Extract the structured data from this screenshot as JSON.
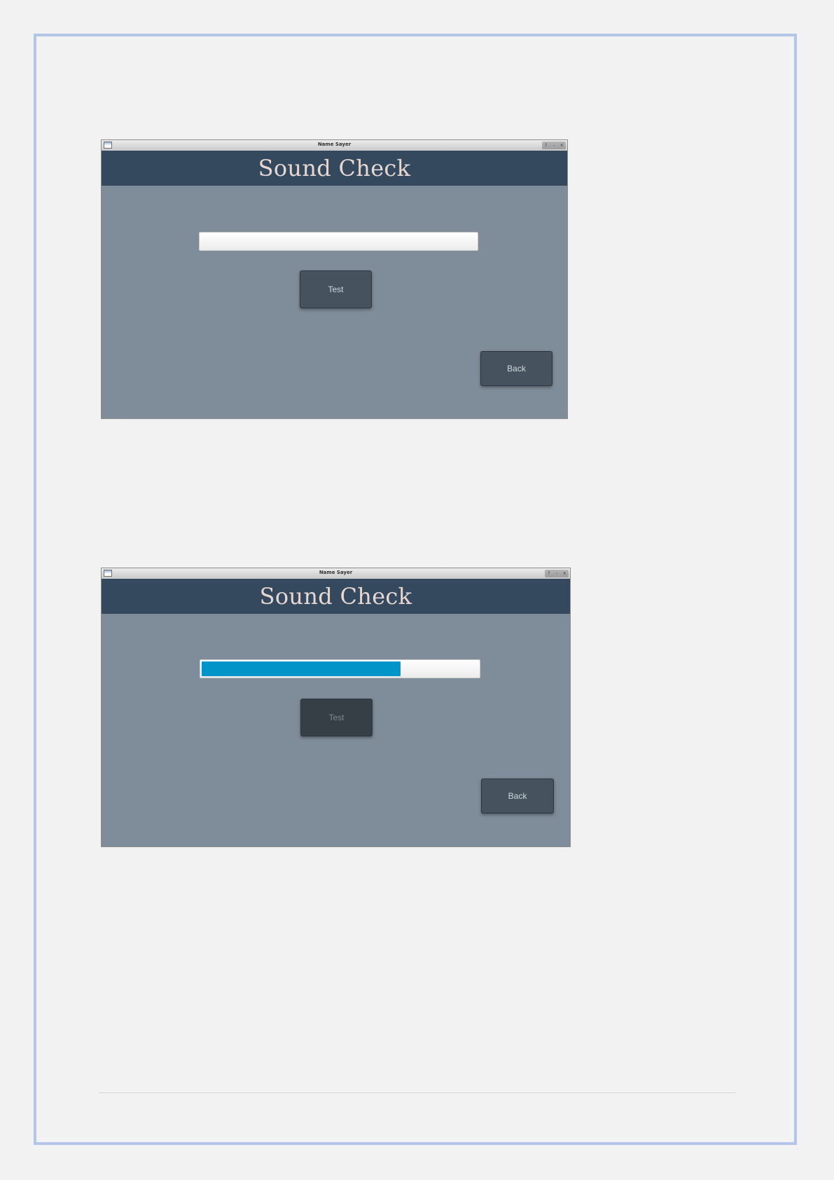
{
  "screenshots": [
    {
      "window_title": "Name Sayer",
      "window_controls": [
        "?",
        "-",
        "×"
      ],
      "heading": "Sound Check",
      "progress": {
        "value": 0
      },
      "test_button": {
        "label": "Test",
        "enabled": true
      },
      "back_button": {
        "label": "Back",
        "enabled": true
      }
    },
    {
      "window_title": "Name Sayer",
      "window_controls": [
        "?",
        "-",
        "×"
      ],
      "heading": "Sound Check",
      "progress": {
        "value": 0.72
      },
      "test_button": {
        "label": "Test",
        "enabled": false
      },
      "back_button": {
        "label": "Back",
        "enabled": true
      }
    }
  ],
  "colors": {
    "header_band": "#34495e",
    "content_background": "#7f8c99",
    "progress_fill": "#0094c8",
    "button_background": "#46535f",
    "page_border": "#b4c6e7"
  },
  "icons": {
    "window_icon": "app-window-icon",
    "help": "help-icon",
    "minimize": "minimize-icon",
    "close": "close-icon"
  }
}
